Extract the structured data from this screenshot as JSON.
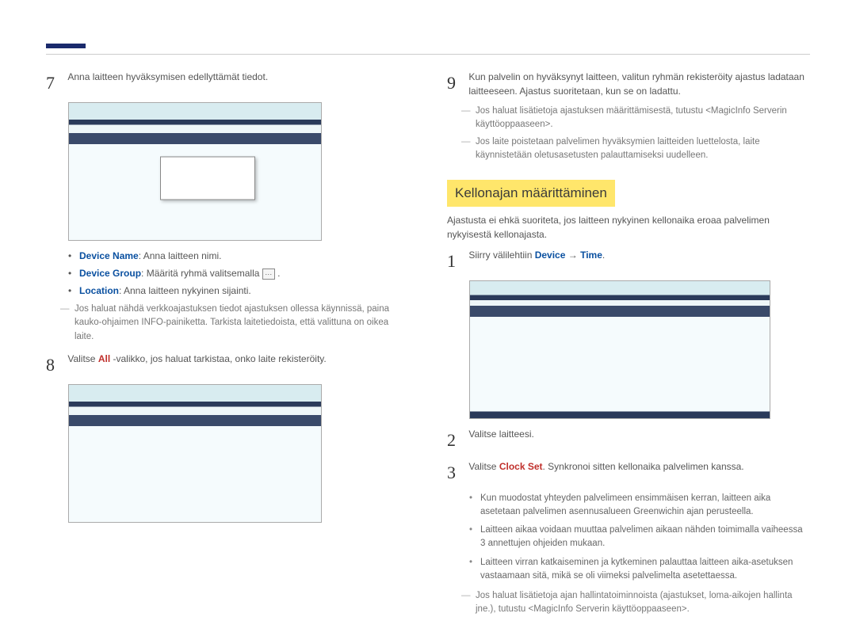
{
  "left": {
    "step7": {
      "num": "7",
      "text": "Anna laitteen hyväksymisen edellyttämät tiedot."
    },
    "bullets": [
      {
        "label": "Device Name",
        "rest": ": Anna laitteen nimi."
      },
      {
        "label": "Device Group",
        "rest": ": Määritä ryhmä valitsemalla "
      },
      {
        "label": "Location",
        "rest": ": Anna laitteen nykyinen sijainti."
      }
    ],
    "dash7": "Jos haluat nähdä verkkoajastuksen tiedot ajastuksen ollessa käynnissä, paina kauko-ohjaimen INFO-painiketta. Tarkista laitetiedoista, että valittuna on oikea laite.",
    "step8": {
      "num": "8",
      "pre": "Valitse ",
      "red": "All",
      "post": " -valikko, jos haluat tarkistaa, onko laite rekisteröity."
    }
  },
  "right": {
    "step9": {
      "num": "9",
      "text": "Kun palvelin on hyväksynyt laitteen, valitun ryhmän rekisteröity ajastus ladataan laitteeseen. Ajastus suoritetaan, kun se on ladattu."
    },
    "dashes9": [
      "Jos haluat lisätietoja ajastuksen määrittämisestä, tutustu <MagicInfo Serverin käyttöoppaaseen>.",
      "Jos laite poistetaan palvelimen hyväksymien laitteiden luettelosta, laite käynnistetään oletusasetusten palauttamiseksi uudelleen."
    ],
    "section_title": "Kellonajan määrittäminen",
    "intro": "Ajastusta ei ehkä suoriteta, jos laitteen nykyinen kellonaika eroaa palvelimen nykyisestä kellonajasta.",
    "step1": {
      "num": "1",
      "pre": "Siirry välilehtiin ",
      "blue1": "Device",
      "arrow": " → ",
      "blue2": "Time",
      "post": "."
    },
    "step2": {
      "num": "2",
      "text": "Valitse laitteesi."
    },
    "step3": {
      "num": "3",
      "pre": "Valitse ",
      "red": "Clock Set",
      "post": ". Synkronoi sitten kellonaika palvelimen kanssa."
    },
    "sub": [
      "Kun muodostat yhteyden palvelimeen ensimmäisen kerran, laitteen aika asetetaan palvelimen asennusalueen Greenwichin ajan perusteella.",
      "Laitteen aikaa voidaan muuttaa palvelimen aikaan nähden toimimalla vaiheessa 3 annettujen ohjeiden mukaan.",
      "Laitteen virran katkaiseminen ja kytkeminen palauttaa laitteen aika-asetuksen vastaamaan sitä, mikä se oli viimeksi palvelimelta asetettaessa."
    ],
    "dash_bottom": "Jos haluat lisätietoja ajan hallintatoiminnoista (ajastukset, loma-aikojen hallinta jne.), tutustu <MagicInfo Serverin käyttöoppaaseen>."
  }
}
